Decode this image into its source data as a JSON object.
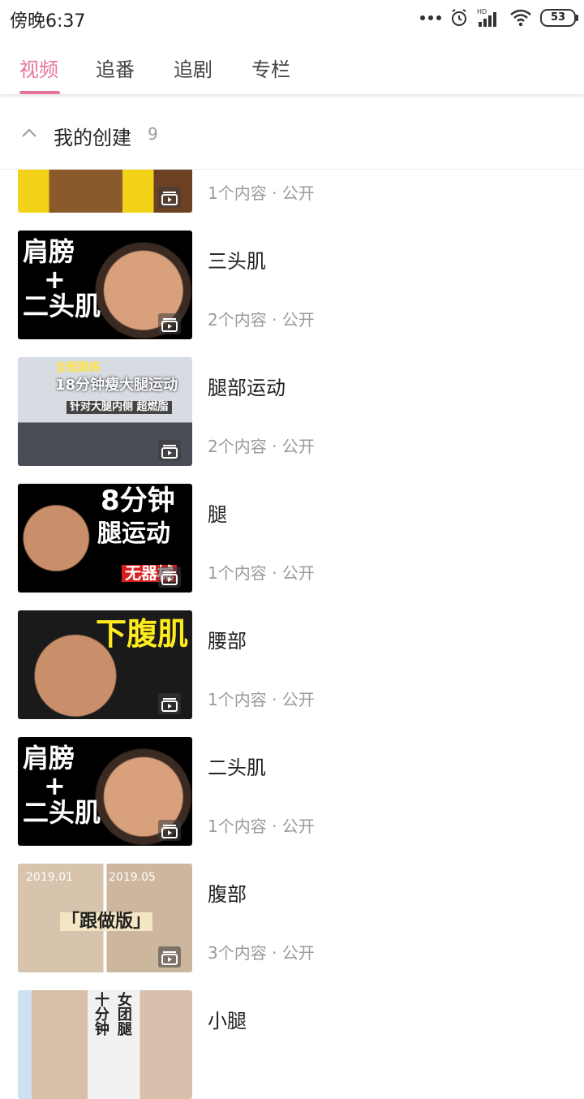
{
  "status": {
    "time": "傍晚6:37",
    "battery": "53",
    "hd": "HD"
  },
  "tabs": [
    {
      "label": "视频"
    },
    {
      "label": "追番"
    },
    {
      "label": "追剧"
    },
    {
      "label": "专栏"
    }
  ],
  "section": {
    "title": "我的创建",
    "count": "9"
  },
  "items": [
    {
      "title": "",
      "meta": "1个内容 · 公开",
      "thumb_text": ""
    },
    {
      "title": "三头肌",
      "meta": "2个内容 · 公开",
      "thumb_text": "肩膀 + 二头肌"
    },
    {
      "title": "腿部运动",
      "meta": "2个内容 · 公开",
      "thumb_text_line1": "全程跟练",
      "thumb_text_line2": "18分钟瘦大腿运动",
      "thumb_text_line3": "针对大腿内侧 超燃脂"
    },
    {
      "title": "腿",
      "meta": "1个内容 · 公开",
      "thumb_text_line1": "8分钟",
      "thumb_text_line2": "腿运动",
      "thumb_text_line3": "无器械"
    },
    {
      "title": "腰部",
      "meta": "1个内容 · 公开",
      "thumb_text": "下腹肌"
    },
    {
      "title": "二头肌",
      "meta": "1个内容 · 公开",
      "thumb_text": "肩膀 + 二头肌"
    },
    {
      "title": "腹部",
      "meta": "3个内容 · 公开",
      "thumb_text_line1": "2019.01",
      "thumb_text_line2": "2019.05",
      "thumb_text_line3": "「跟做版」"
    },
    {
      "title": "小腿",
      "meta": "",
      "thumb_text_line1": "十分钟",
      "thumb_text_line2": "女团腿"
    }
  ],
  "colors": {
    "accent": "#e9749b",
    "meta": "#9a9a9a",
    "badge_bg": "rgba(60,60,60,0.55)"
  }
}
